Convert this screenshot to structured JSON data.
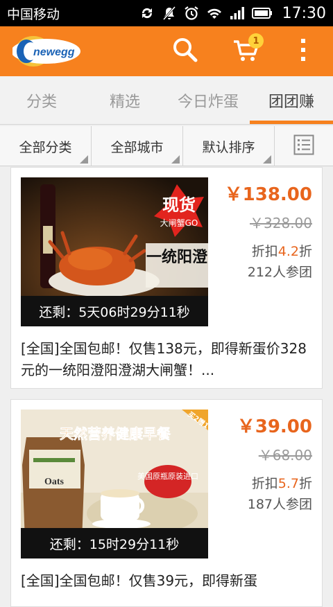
{
  "status_bar": {
    "carrier": "中国移动",
    "time": "17:30"
  },
  "app_bar": {
    "logo_text": "newegg",
    "cart_count": "1"
  },
  "tabs": [
    {
      "label": "分类"
    },
    {
      "label": "精选"
    },
    {
      "label": "今日炸蛋"
    },
    {
      "label": "团团赚"
    }
  ],
  "active_tab": "团团赚",
  "filters": [
    {
      "label": "全部分类"
    },
    {
      "label": "全部城市"
    },
    {
      "label": "默认排序"
    }
  ],
  "deals": [
    {
      "image_caption_main": "现货",
      "image_caption_sub": "大闸蟹GO",
      "image_caption_2": "一统阳澄",
      "countdown": "还剩：5天06时29分11秒",
      "price": "￥138.00",
      "original_price": "￥328.00",
      "discount_prefix": "折扣",
      "discount_value": "4.2",
      "discount_suffix": "折",
      "joined": "212人参团",
      "description": "[全国]全国包邮！仅售138元，即得新蛋价328元的一统阳澄阳澄湖大闸蟹！..."
    },
    {
      "image_caption_main": "天然营养健康早餐",
      "image_caption_sub": "美国原瓶原装进口",
      "image_corner": "买2赠1",
      "package_text": "Oats",
      "countdown": "还剩：15时29分11秒",
      "price": "￥39.00",
      "original_price": "￥68.00",
      "discount_prefix": "折扣",
      "discount_value": "5.7",
      "discount_suffix": "折",
      "joined": "187人参团",
      "description": "[全国]全国包邮！仅售39元，即得新蛋"
    }
  ],
  "colors": {
    "accent": "#f7811e",
    "price": "#e8651d"
  }
}
